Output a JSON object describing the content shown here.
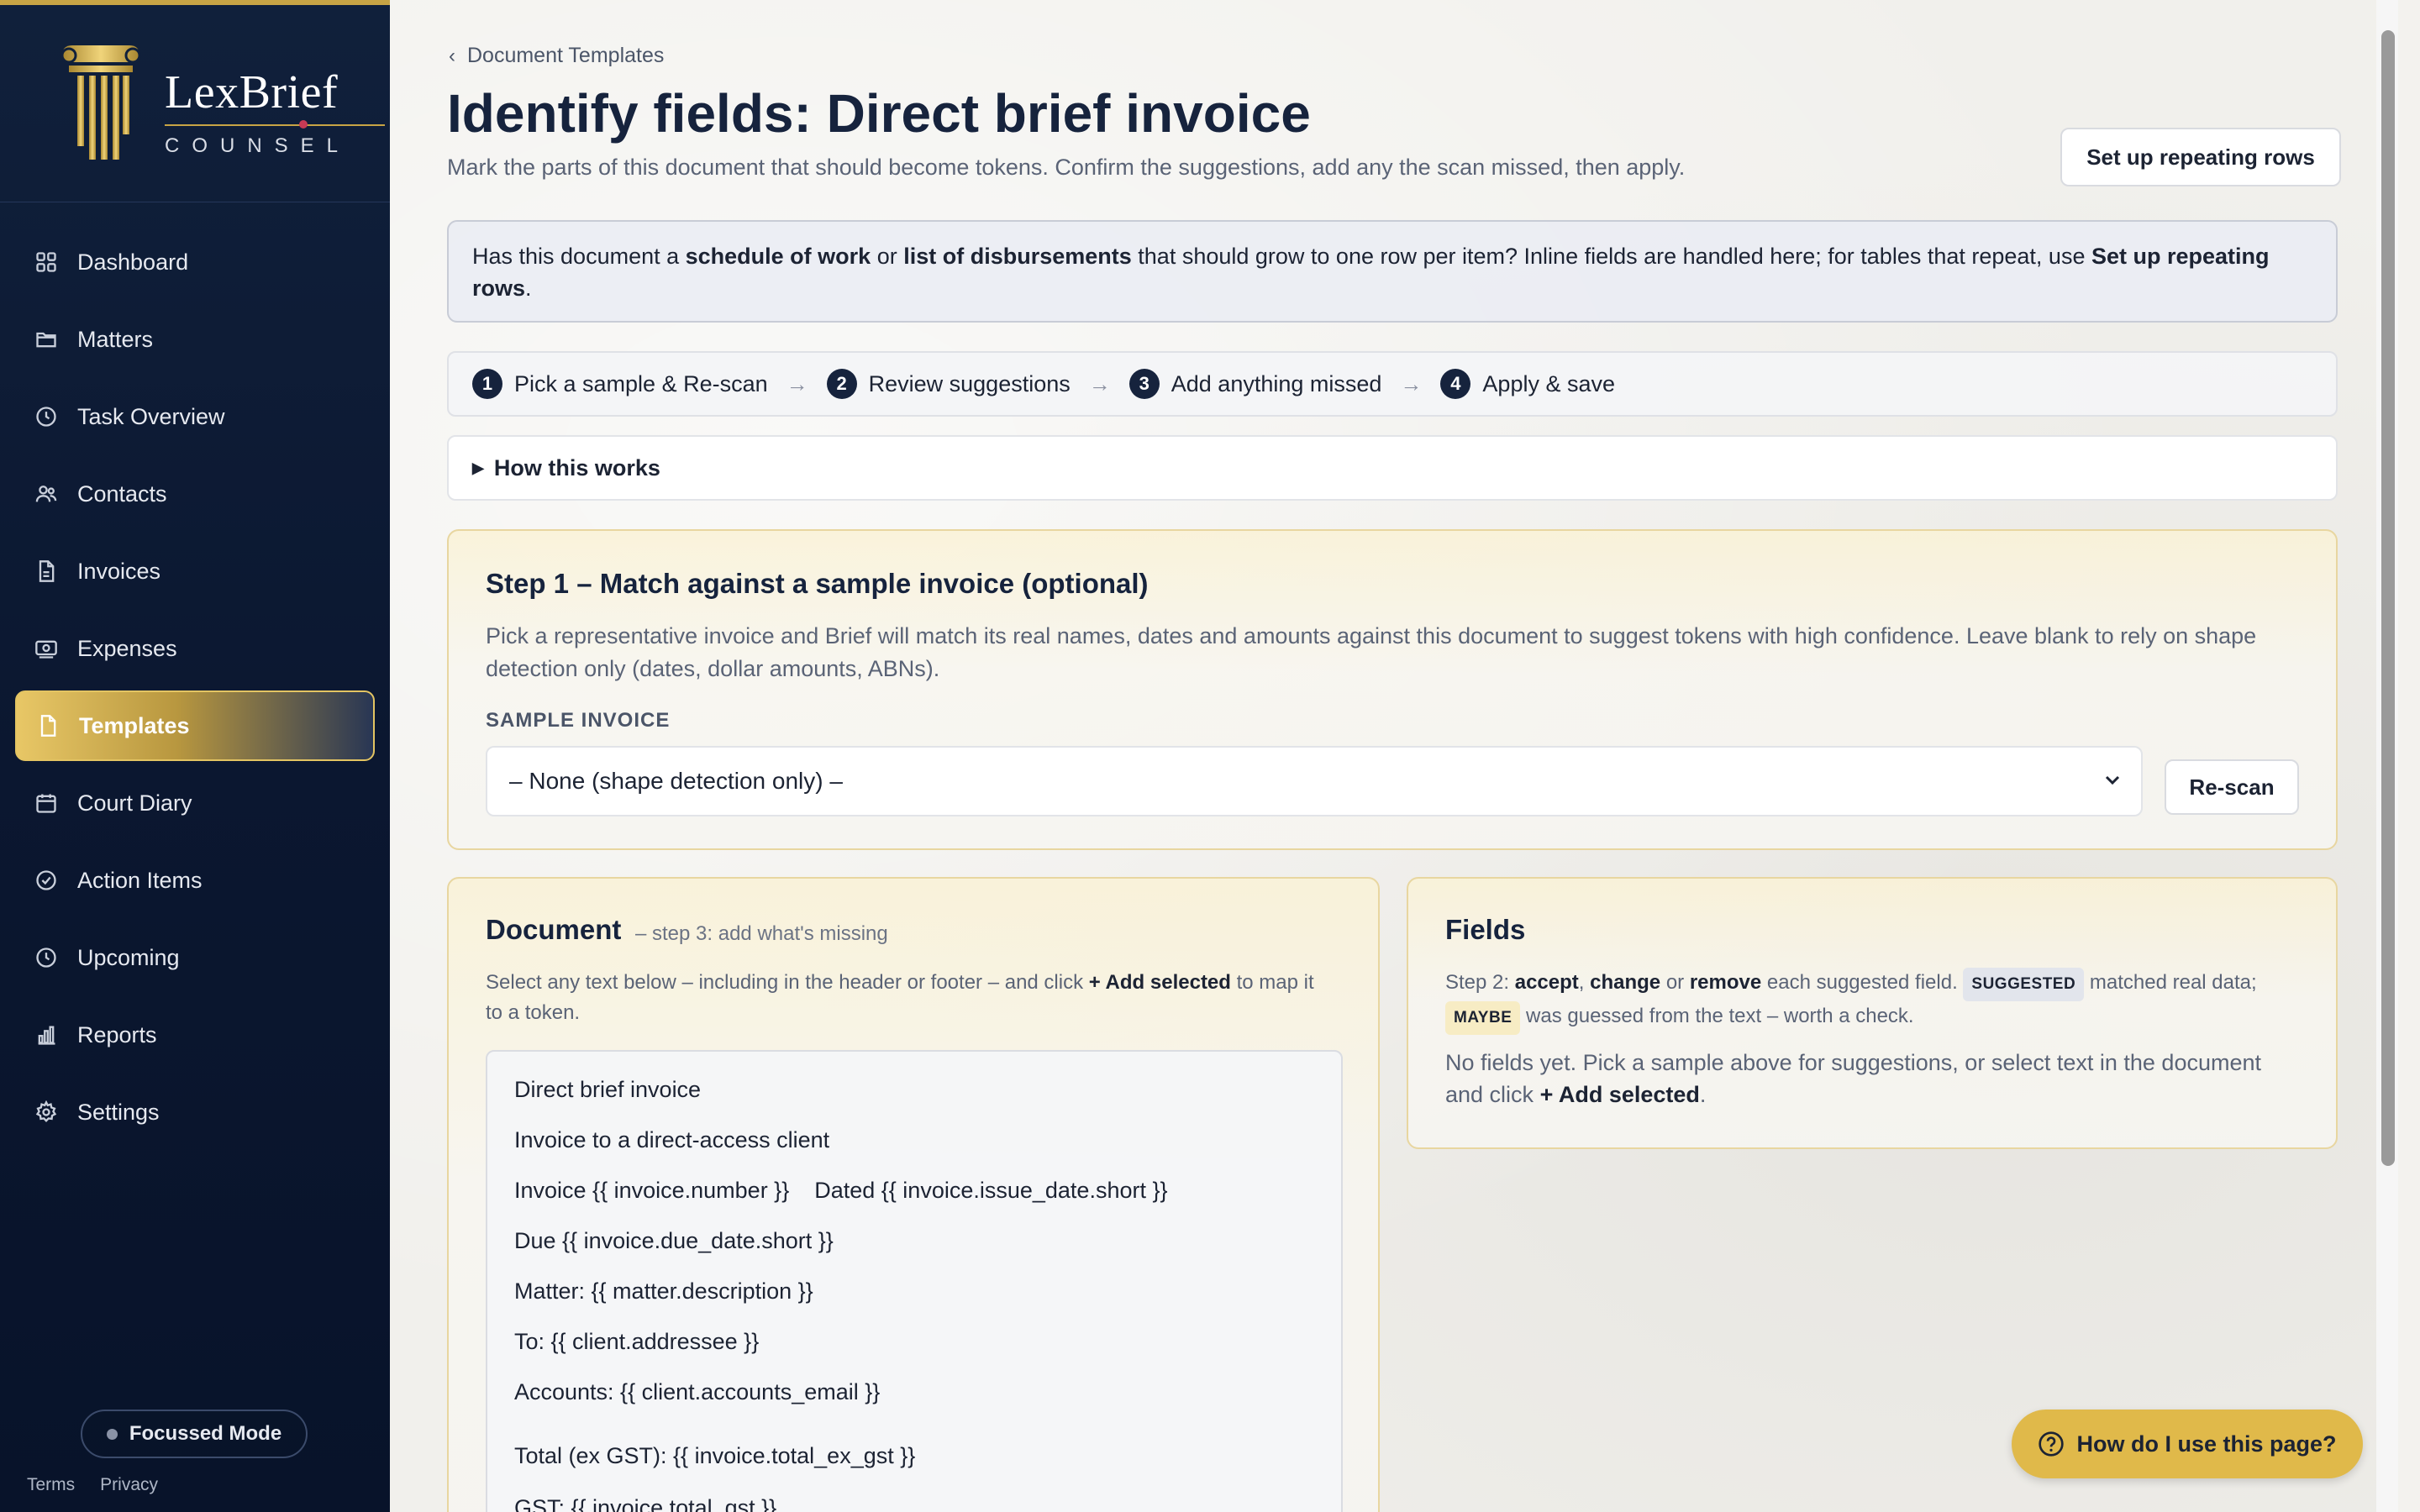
{
  "brand": {
    "name": "LexBrief",
    "tagline": "COUNSEL",
    "gold": "#c7a445",
    "navy": "#10203b"
  },
  "sidebar": {
    "items": [
      {
        "label": "Dashboard",
        "icon": "dashboard-icon",
        "active": false
      },
      {
        "label": "Matters",
        "icon": "folder-icon",
        "active": false
      },
      {
        "label": "Task Overview",
        "icon": "clock-icon",
        "active": false
      },
      {
        "label": "Contacts",
        "icon": "contacts-icon",
        "active": false
      },
      {
        "label": "Invoices",
        "icon": "document-icon",
        "active": false
      },
      {
        "label": "Expenses",
        "icon": "money-icon",
        "active": false
      },
      {
        "label": "Templates",
        "icon": "template-icon",
        "active": true
      },
      {
        "label": "Court Diary",
        "icon": "calendar-icon",
        "active": false
      },
      {
        "label": "Action Items",
        "icon": "check-circle-icon",
        "active": false
      },
      {
        "label": "Upcoming",
        "icon": "clock-icon",
        "active": false
      },
      {
        "label": "Reports",
        "icon": "bar-chart-icon",
        "active": false
      },
      {
        "label": "Settings",
        "icon": "gear-icon",
        "active": false
      }
    ],
    "focus_mode": "Focussed Mode",
    "footer": {
      "terms": "Terms",
      "privacy": "Privacy"
    }
  },
  "header": {
    "breadcrumb": "Document Templates",
    "title": "Identify fields: Direct brief invoice",
    "subtitle": "Mark the parts of this document that should become tokens. Confirm the suggestions, add any the scan missed, then apply.",
    "repeat_button": "Set up repeating rows"
  },
  "notice": {
    "t1": "Has this document a ",
    "b1": "schedule of work",
    "t2": " or ",
    "b2": "list of disbursements",
    "t3": " that should grow to one row per item? Inline fields are handled here; for tables that repeat, use ",
    "b3": "Set up repeating rows",
    "t4": "."
  },
  "steps": [
    {
      "num": "1",
      "label": "Pick a sample & Re-scan"
    },
    {
      "num": "2",
      "label": "Review suggestions"
    },
    {
      "num": "3",
      "label": "Add anything missed"
    },
    {
      "num": "4",
      "label": "Apply & save"
    }
  ],
  "step_arrow": "→",
  "how_it_works": "How this works",
  "step1": {
    "title": "Step 1 – Match against a sample invoice (optional)",
    "description": "Pick a representative invoice and Brief will match its real names, dates and amounts against this document to suggest tokens with high confidence. Leave blank to rely on shape detection only (dates, dollar amounts, ABNs).",
    "label": "SAMPLE INVOICE",
    "selected": "– None (shape detection only) –",
    "rescan": "Re-scan"
  },
  "document": {
    "title": "Document",
    "hint": "– step 3: add what's missing",
    "desc_a": "Select any text below – including in the header or footer – and click ",
    "desc_b": "+ Add selected",
    "desc_c": " to map it to a token.",
    "lines": [
      "Direct brief invoice",
      "Invoice to a direct-access client",
      "Invoice {{ invoice.number }}    Dated {{ invoice.issue_date.short }}",
      "Due {{ invoice.due_date.short }}",
      "Matter: {{ matter.description }}",
      "To: {{ client.addressee }}",
      "Accounts: {{ client.accounts_email }}",
      "Total (ex GST): {{ invoice.total_ex_gst }}",
      "GST: {{ invoice.total_gst }}"
    ]
  },
  "fields": {
    "title": "Fields",
    "p1": "Step 2: ",
    "accept": "accept",
    "comma": ", ",
    "change": "change",
    "or": " or ",
    "remove": "remove",
    "p2": " each suggested field. ",
    "badge_suggested": "SUGGESTED",
    "p3": " matched real data; ",
    "badge_maybe": "MAYBE",
    "p4": " was guessed from the text – worth a check.",
    "empty_a": "No fields yet. Pick a sample above for suggestions, or select text in the document and click ",
    "empty_b": "+ Add selected",
    "empty_c": "."
  },
  "help": "How do I use this page?"
}
